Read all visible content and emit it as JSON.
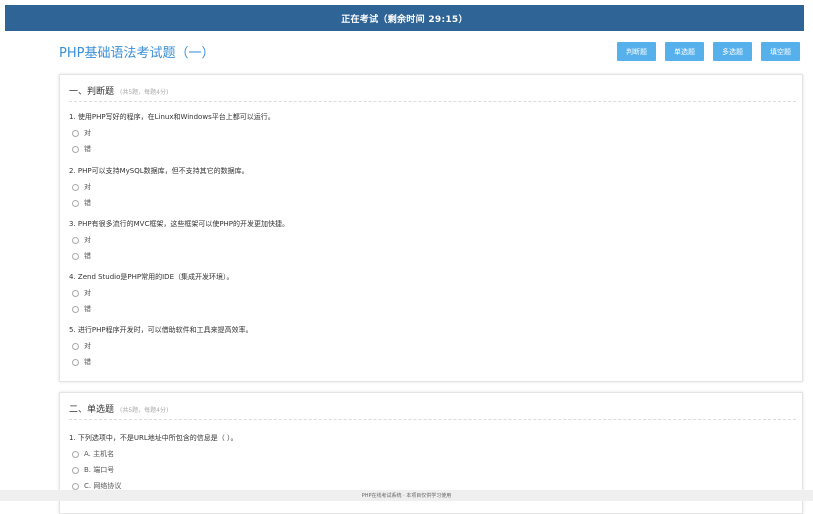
{
  "header": {
    "title": "正在考试（剩余时间 29:15）"
  },
  "exam": {
    "title": "PHP基础语法考试题（一）"
  },
  "toolbar": {
    "buttons": [
      "判断题",
      "单选题",
      "多选题",
      "填空题"
    ]
  },
  "section1": {
    "title": "一、判断题",
    "note": "(共5题，每题4分)",
    "questions": [
      {
        "text": "1. 使用PHP写好的程序，在Linux和Windows平台上都可以运行。",
        "options": [
          "对",
          "错"
        ]
      },
      {
        "text": "2. PHP可以支持MySQL数据库，但不支持其它的数据库。",
        "options": [
          "对",
          "错"
        ]
      },
      {
        "text": "3. PHP有很多流行的MVC框架，这些框架可以使PHP的开发更加快捷。",
        "options": [
          "对",
          "错"
        ]
      },
      {
        "text": "4. Zend Studio是PHP常用的IDE（集成开发环境）。",
        "options": [
          "对",
          "错"
        ]
      },
      {
        "text": "5. 进行PHP程序开发时，可以借助软件和工具来提高效率。",
        "options": [
          "对",
          "错"
        ]
      }
    ]
  },
  "section2": {
    "title": "二、单选题",
    "note": "(共5题，每题4分)",
    "questions": [
      {
        "text": "1. 下列选项中，不是URL地址中所包含的信息是（ ）。",
        "options": [
          "A. 主机名",
          "B. 端口号",
          "C. 网络协议"
        ]
      }
    ]
  },
  "footer": {
    "text": "PHP在线考试系统 · 本项目仅供学习使用"
  }
}
